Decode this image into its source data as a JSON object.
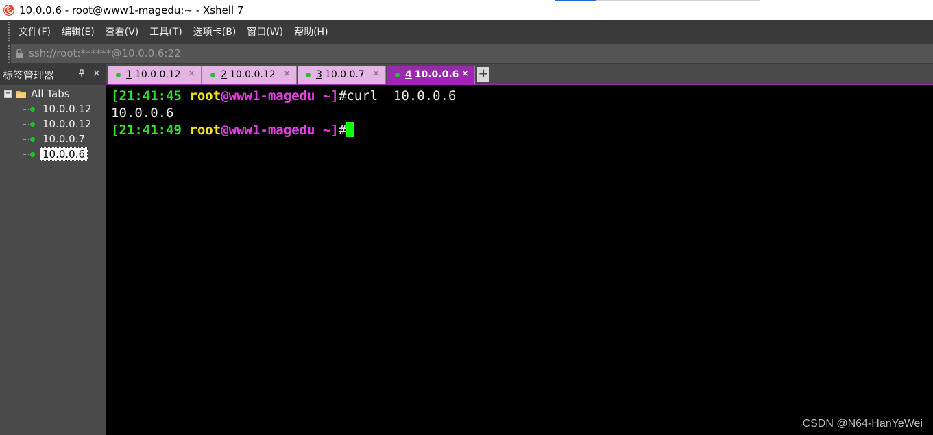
{
  "window": {
    "title": "10.0.0.6 - root@www1-magedu:~ - Xshell 7",
    "icon": "xshell-logo-icon"
  },
  "menu": {
    "items": [
      {
        "label": "文件(F)"
      },
      {
        "label": "编辑(E)"
      },
      {
        "label": "查看(V)"
      },
      {
        "label": "工具(T)"
      },
      {
        "label": "选项卡(B)"
      },
      {
        "label": "窗口(W)"
      },
      {
        "label": "帮助(H)"
      }
    ]
  },
  "address": {
    "icon": "lock-icon",
    "value": "ssh://root:******@10.0.0.6:22"
  },
  "tab_manager": {
    "title": "标签管理器",
    "pin_glyph": "ᚴ",
    "close_glyph": "×",
    "root": {
      "expander": "−",
      "label": "All Tabs"
    },
    "items": [
      {
        "label": "10.0.0.12"
      },
      {
        "label": "10.0.0.12"
      },
      {
        "label": "10.0.0.7"
      },
      {
        "label": "10.0.0.6",
        "selected": true
      }
    ]
  },
  "tabs": [
    {
      "num": "1",
      "label": "10.0.0.12"
    },
    {
      "num": "2",
      "label": "10.0.0.12"
    },
    {
      "num": "3",
      "label": "10.0.0.7"
    },
    {
      "num": "4",
      "label": "10.0.0.6",
      "active": true
    }
  ],
  "tab_close_glyph": "×",
  "tab_add_glyph": "+",
  "terminal": {
    "lines": [
      {
        "bracket_open": "[",
        "time": "21:41:45",
        "user": "root",
        "at_host": "@www1-magedu",
        "path": " ~",
        "bracket_close": "]",
        "prompt_char": "#",
        "command": "curl  10.0.0.6"
      },
      {
        "output": "10.0.0.6"
      },
      {
        "bracket_open": "[",
        "time": "21:41:49",
        "user": "root",
        "at_host": "@www1-magedu",
        "path": " ~",
        "bracket_close": "]",
        "prompt_char": "#",
        "command": ""
      }
    ]
  },
  "watermark": "CSDN @N64-HanYeWei",
  "colors": {
    "prompt_green": "#2ee02e",
    "user_yellow": "#f5e60a",
    "host_magenta": "#e040e0",
    "active_tab": "#9c27b0",
    "inactive_tab": "#e4b4e4",
    "session_dot": "#22c02a"
  }
}
